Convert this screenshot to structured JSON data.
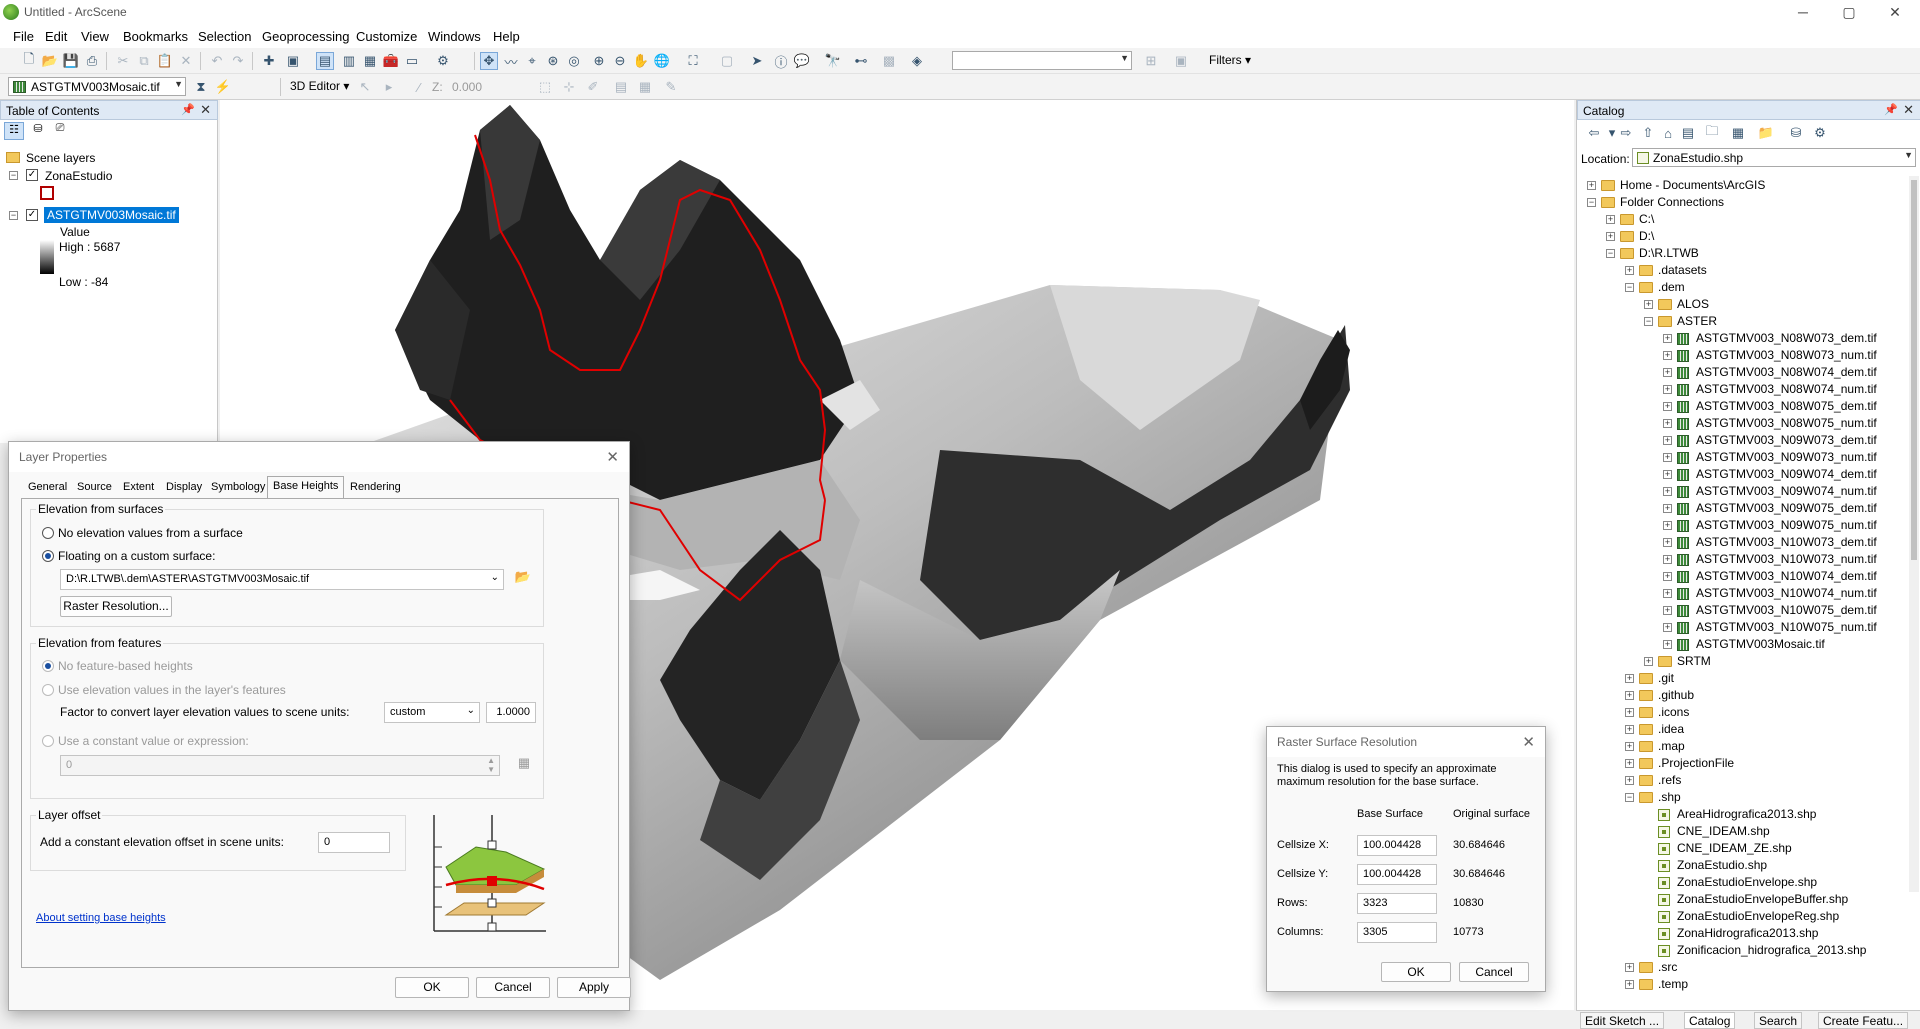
{
  "window": {
    "title": "Untitled - ArcScene",
    "minimize": "─",
    "maximize": "▢",
    "close": "✕"
  },
  "menu": [
    "File",
    "Edit",
    "View",
    "Bookmarks",
    "Selection",
    "Geoprocessing",
    "Customize",
    "Windows",
    "Help"
  ],
  "toolbar": {
    "filters_label": "Filters ▾",
    "layer_combo": "ASTGTMV003Mosaic.tif",
    "editor_3d": "3D Editor ▾",
    "z_label": "Z:",
    "z_value": "0.000"
  },
  "toc": {
    "title": "Table of Contents",
    "scene_layers": "Scene layers",
    "layers": [
      {
        "name": "ZonaEstudio",
        "checked": true
      },
      {
        "name": "ASTGTMV003Mosaic.tif",
        "checked": true,
        "selected": true
      }
    ],
    "legend": {
      "value_label": "Value",
      "high": "High : 5687",
      "low": "Low : -84"
    }
  },
  "catalog": {
    "title": "Catalog",
    "location_label": "Location:",
    "location_value": "ZonaEstudio.shp",
    "tree": [
      {
        "label": "Home - Documents\\ArcGIS",
        "indent": 0,
        "icon": "folder",
        "exp": "+"
      },
      {
        "label": "Folder Connections",
        "indent": 0,
        "icon": "folder",
        "exp": "−"
      },
      {
        "label": "C:\\",
        "indent": 1,
        "icon": "folder",
        "exp": "+"
      },
      {
        "label": "D:\\",
        "indent": 1,
        "icon": "folder",
        "exp": "+"
      },
      {
        "label": "D:\\R.LTWB",
        "indent": 1,
        "icon": "folder",
        "exp": "−"
      },
      {
        "label": ".datasets",
        "indent": 2,
        "icon": "folder",
        "exp": "+"
      },
      {
        "label": ".dem",
        "indent": 2,
        "icon": "folder",
        "exp": "−"
      },
      {
        "label": "ALOS",
        "indent": 3,
        "icon": "folder",
        "exp": "+"
      },
      {
        "label": "ASTER",
        "indent": 3,
        "icon": "folder",
        "exp": "−"
      },
      {
        "label": "ASTGTMV003_N08W073_dem.tif",
        "indent": 4,
        "icon": "raster",
        "exp": "+"
      },
      {
        "label": "ASTGTMV003_N08W073_num.tif",
        "indent": 4,
        "icon": "raster",
        "exp": "+"
      },
      {
        "label": "ASTGTMV003_N08W074_dem.tif",
        "indent": 4,
        "icon": "raster",
        "exp": "+"
      },
      {
        "label": "ASTGTMV003_N08W074_num.tif",
        "indent": 4,
        "icon": "raster",
        "exp": "+"
      },
      {
        "label": "ASTGTMV003_N08W075_dem.tif",
        "indent": 4,
        "icon": "raster",
        "exp": "+"
      },
      {
        "label": "ASTGTMV003_N08W075_num.tif",
        "indent": 4,
        "icon": "raster",
        "exp": "+"
      },
      {
        "label": "ASTGTMV003_N09W073_dem.tif",
        "indent": 4,
        "icon": "raster",
        "exp": "+"
      },
      {
        "label": "ASTGTMV003_N09W073_num.tif",
        "indent": 4,
        "icon": "raster",
        "exp": "+"
      },
      {
        "label": "ASTGTMV003_N09W074_dem.tif",
        "indent": 4,
        "icon": "raster",
        "exp": "+"
      },
      {
        "label": "ASTGTMV003_N09W074_num.tif",
        "indent": 4,
        "icon": "raster",
        "exp": "+"
      },
      {
        "label": "ASTGTMV003_N09W075_dem.tif",
        "indent": 4,
        "icon": "raster",
        "exp": "+"
      },
      {
        "label": "ASTGTMV003_N09W075_num.tif",
        "indent": 4,
        "icon": "raster",
        "exp": "+"
      },
      {
        "label": "ASTGTMV003_N10W073_dem.tif",
        "indent": 4,
        "icon": "raster",
        "exp": "+"
      },
      {
        "label": "ASTGTMV003_N10W073_num.tif",
        "indent": 4,
        "icon": "raster",
        "exp": "+"
      },
      {
        "label": "ASTGTMV003_N10W074_dem.tif",
        "indent": 4,
        "icon": "raster",
        "exp": "+"
      },
      {
        "label": "ASTGTMV003_N10W074_num.tif",
        "indent": 4,
        "icon": "raster",
        "exp": "+"
      },
      {
        "label": "ASTGTMV003_N10W075_dem.tif",
        "indent": 4,
        "icon": "raster",
        "exp": "+"
      },
      {
        "label": "ASTGTMV003_N10W075_num.tif",
        "indent": 4,
        "icon": "raster",
        "exp": "+"
      },
      {
        "label": "ASTGTMV003Mosaic.tif",
        "indent": 4,
        "icon": "raster",
        "exp": "+"
      },
      {
        "label": "SRTM",
        "indent": 3,
        "icon": "folder",
        "exp": "+"
      },
      {
        "label": ".git",
        "indent": 2,
        "icon": "folder",
        "exp": "+"
      },
      {
        "label": ".github",
        "indent": 2,
        "icon": "folder",
        "exp": "+"
      },
      {
        "label": ".icons",
        "indent": 2,
        "icon": "folder",
        "exp": "+"
      },
      {
        "label": ".idea",
        "indent": 2,
        "icon": "folder",
        "exp": "+"
      },
      {
        "label": ".map",
        "indent": 2,
        "icon": "folder",
        "exp": "+"
      },
      {
        "label": ".ProjectionFile",
        "indent": 2,
        "icon": "folder",
        "exp": "+"
      },
      {
        "label": ".refs",
        "indent": 2,
        "icon": "folder",
        "exp": "+"
      },
      {
        "label": ".shp",
        "indent": 2,
        "icon": "folder",
        "exp": "−"
      },
      {
        "label": "AreaHidrografica2013.shp",
        "indent": 3,
        "icon": "shp",
        "exp": ""
      },
      {
        "label": "CNE_IDEAM.shp",
        "indent": 3,
        "icon": "shp",
        "exp": ""
      },
      {
        "label": "CNE_IDEAM_ZE.shp",
        "indent": 3,
        "icon": "shp",
        "exp": ""
      },
      {
        "label": "ZonaEstudio.shp",
        "indent": 3,
        "icon": "shp",
        "exp": ""
      },
      {
        "label": "ZonaEstudioEnvelope.shp",
        "indent": 3,
        "icon": "shp",
        "exp": ""
      },
      {
        "label": "ZonaEstudioEnvelopeBuffer.shp",
        "indent": 3,
        "icon": "shp",
        "exp": ""
      },
      {
        "label": "ZonaEstudioEnvelopeReg.shp",
        "indent": 3,
        "icon": "shp",
        "exp": ""
      },
      {
        "label": "ZonaHidrografica2013.shp",
        "indent": 3,
        "icon": "shp",
        "exp": ""
      },
      {
        "label": "Zonificacion_hidrografica_2013.shp",
        "indent": 3,
        "icon": "shp",
        "exp": ""
      },
      {
        "label": ".src",
        "indent": 2,
        "icon": "folder",
        "exp": "+"
      },
      {
        "label": ".temp",
        "indent": 2,
        "icon": "folder",
        "exp": "+"
      }
    ],
    "bottom_tabs": [
      "Edit Sketch ...",
      "Catalog",
      "Search",
      "Create Featu..."
    ]
  },
  "layer_properties": {
    "title": "Layer Properties",
    "tabs": [
      "General",
      "Source",
      "Extent",
      "Display",
      "Symbology",
      "Base Heights",
      "Rendering"
    ],
    "active_tab": "Base Heights",
    "elev_surfaces_label": "Elevation from surfaces",
    "no_elev_label": "No elevation values from a surface",
    "floating_label": "Floating on a custom surface:",
    "surface_path": "D:\\R.LTWB\\.dem\\ASTER\\ASTGTMV003Mosaic.tif",
    "raster_res_button": "Raster Resolution...",
    "elev_features_label": "Elevation from features",
    "no_feature_label": "No feature-based heights",
    "use_elev_label": "Use elevation values in the layer's features",
    "factor_label": "Factor to convert layer elevation values to scene units:",
    "factor_unit": "custom",
    "factor_value": "1.0000",
    "constant_label": "Use a constant value or expression:",
    "constant_value": "0",
    "offset_group": "Layer offset",
    "offset_label": "Add a constant elevation offset in scene units:",
    "offset_value": "0",
    "help_link": "About setting base heights",
    "ok": "OK",
    "cancel": "Cancel",
    "apply": "Apply"
  },
  "raster_resolution": {
    "title": "Raster Surface Resolution",
    "description": "This dialog is used to specify an approximate maximum resolution for the base surface.",
    "col_base": "Base Surface",
    "col_original": "Original surface",
    "rows": [
      {
        "label": "Cellsize X:",
        "base": "100.004428",
        "original": "30.684646"
      },
      {
        "label": "Cellsize Y:",
        "base": "100.004428",
        "original": "30.684646"
      },
      {
        "label": "Rows:",
        "base": "3323",
        "original": "10830"
      },
      {
        "label": "Columns:",
        "base": "3305",
        "original": "10773"
      }
    ],
    "ok": "OK",
    "cancel": "Cancel"
  },
  "colors": {
    "accent": "#0078d7",
    "boundary": "#e00000",
    "panel_header": "#dfe9f5"
  }
}
